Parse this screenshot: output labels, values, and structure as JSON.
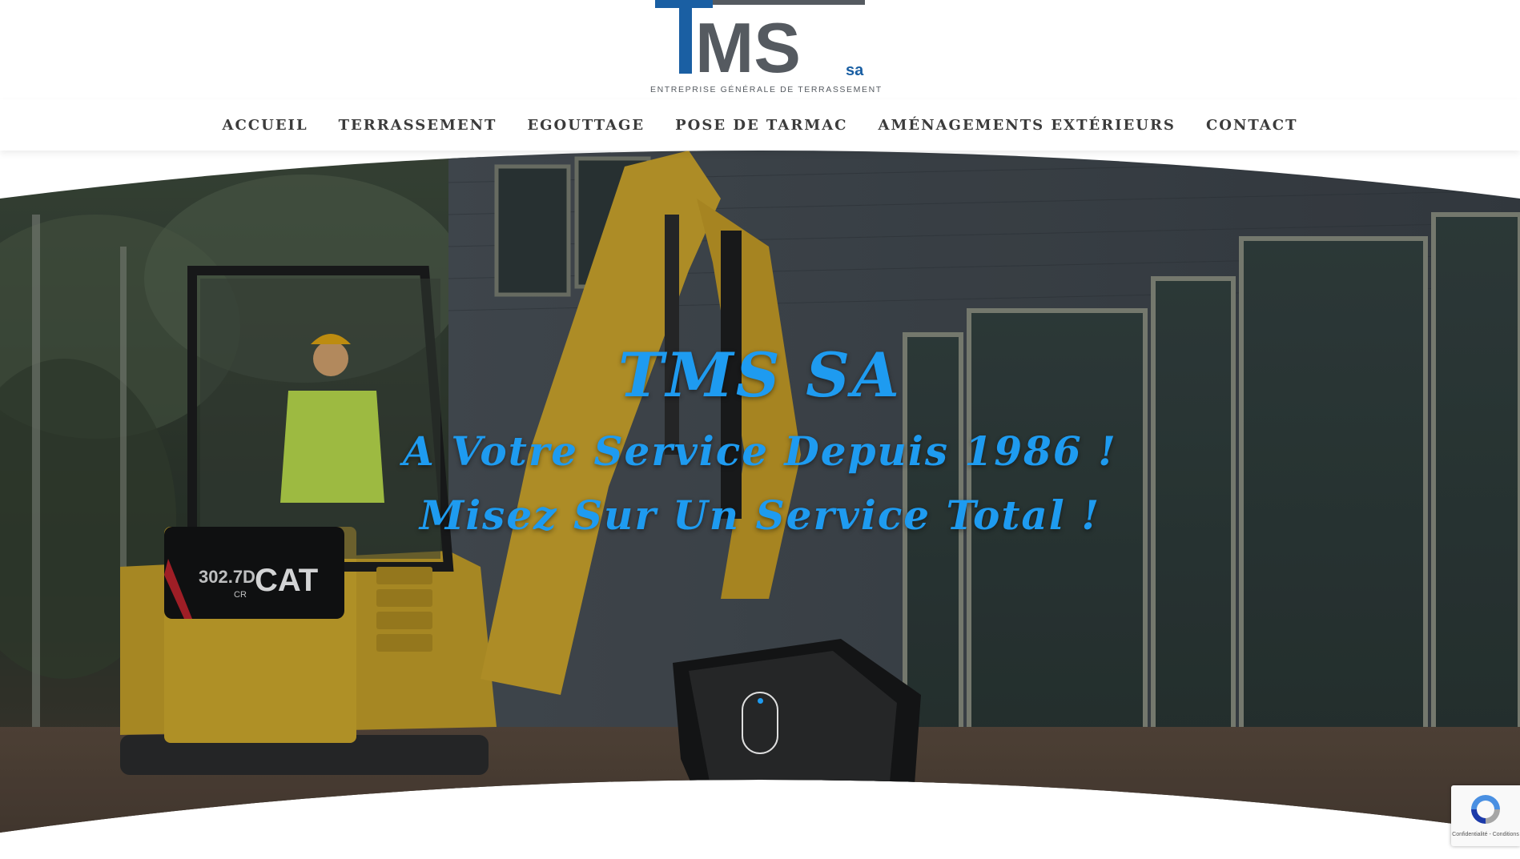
{
  "brand": {
    "logo_main": "MS",
    "logo_suffix": "sa",
    "tagline": "ENTREPRISE GÉNÉRALE DE TERRASSEMENT",
    "colors": {
      "blue": "#1a5fa3",
      "grey": "#555a60",
      "accent": "#1e9bf0"
    }
  },
  "nav": {
    "items": [
      {
        "label": "ACCUEIL"
      },
      {
        "label": "TERRASSEMENT"
      },
      {
        "label": "EGOUTTAGE"
      },
      {
        "label": "POSE DE TARMAC"
      },
      {
        "label": "AMÉNAGEMENTS EXTÉRIEURS"
      },
      {
        "label": "CONTACT"
      }
    ]
  },
  "hero": {
    "title": "TMS SA",
    "line1": "A Votre Service Depuis 1986 !",
    "line2": "Misez Sur Un Service Total !",
    "excavator_model": "302.7D",
    "excavator_model_sub": "CR",
    "excavator_brand": "CAT",
    "scroll_icon": "mouse-scroll-icon"
  },
  "recaptcha": {
    "text": "Confidentialité - Conditions",
    "icon": "recaptcha-icon"
  }
}
